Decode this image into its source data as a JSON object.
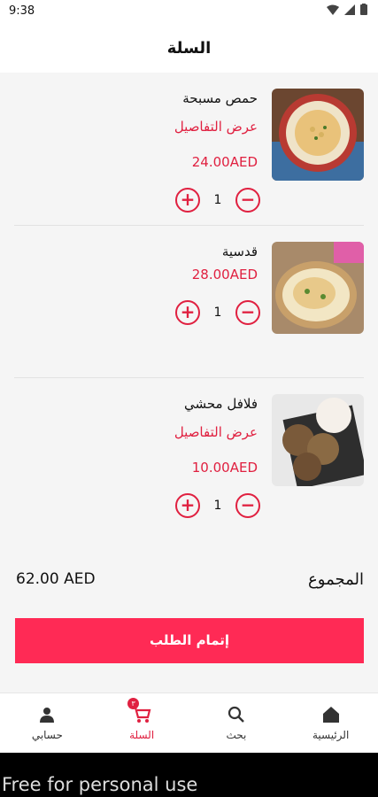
{
  "status": {
    "time": "9:38"
  },
  "header": {
    "title": "السلة"
  },
  "items": [
    {
      "name": "حمص مسبحة",
      "details": "عرض التفاصيل",
      "price": "24.00AED",
      "qty": "1"
    },
    {
      "name": "قدسية",
      "price": "28.00AED",
      "qty": "1"
    },
    {
      "name": "فلافل محشي",
      "details": "عرض التفاصيل",
      "price": "10.00AED",
      "qty": "1"
    }
  ],
  "qty_controls": {
    "plus": "+",
    "minus": "−"
  },
  "total": {
    "label": "المجموع",
    "amount": "62.00 AED"
  },
  "checkout": {
    "label": "إتمام الطلب"
  },
  "nav": {
    "home": "الرئيسية",
    "search": "بحث",
    "cart": "السلة",
    "cart_badge": "٣",
    "account": "حسابي"
  },
  "watermark": "Free for personal use",
  "colors": {
    "accent": "#e02040",
    "button": "#ff2a55"
  }
}
